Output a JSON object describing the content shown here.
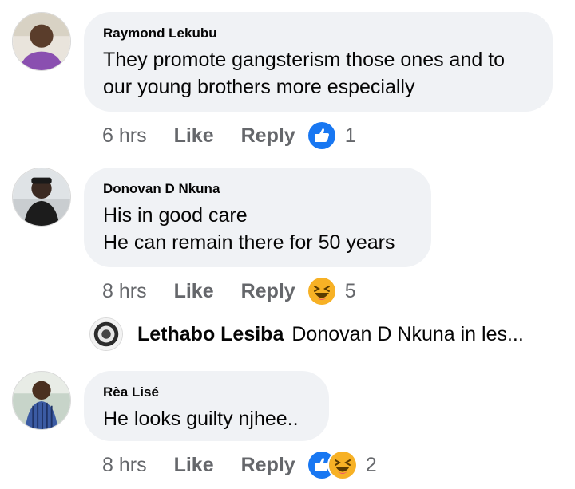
{
  "comments": [
    {
      "author": "Raymond Lekubu",
      "lines": [
        "They promote gangsterism those ones and to",
        "our young brothers more especially"
      ],
      "time": "6 hrs",
      "like": "Like",
      "reply": "Reply",
      "reactions": [
        "like-icon"
      ],
      "count": "1"
    },
    {
      "author": "Donovan D Nkuna",
      "lines": [
        "His in good care",
        "He can remain there for 50 years"
      ],
      "time": "8 hrs",
      "like": "Like",
      "reply": "Reply",
      "reactions": [
        "haha-icon"
      ],
      "count": "5"
    },
    {
      "author": "Rèa Lisé",
      "lines": [
        "He looks guilty njhee.."
      ],
      "time": "8 hrs",
      "like": "Like",
      "reply": "Reply",
      "reactions": [
        "like-icon",
        "haha-icon"
      ],
      "count": "2"
    }
  ],
  "reply_preview": {
    "author": "Lethabo Lesiba",
    "text": "Donovan D Nkuna in les..."
  },
  "colors": {
    "bubble": "#f0f2f5",
    "meta_text": "#65676b",
    "like_blue": "#1877f2",
    "haha_yellow": "#f7b125"
  }
}
